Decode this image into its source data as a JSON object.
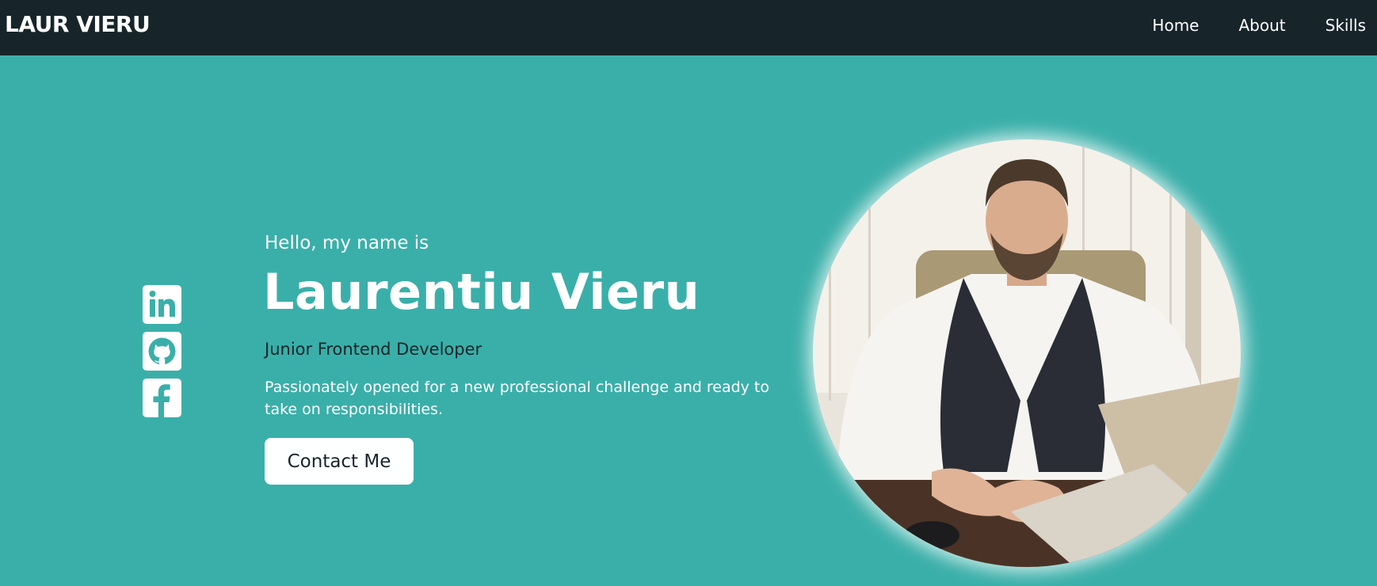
{
  "nav": {
    "brand": "LAUR VIERU",
    "links": [
      {
        "label": "Home"
      },
      {
        "label": "About"
      },
      {
        "label": "Skills"
      }
    ]
  },
  "hero": {
    "greeting": "Hello, my name is",
    "name": "Laurentiu Vieru",
    "role": "Junior Frontend Developer",
    "tagline": "Passionately opened for a new professional challenge and ready to take on responsibilities.",
    "cta_label": "Contact Me"
  },
  "social": [
    {
      "icon": "linkedin-icon"
    },
    {
      "icon": "github-icon"
    },
    {
      "icon": "facebook-icon"
    }
  ],
  "colors": {
    "nav_background": "#17252a",
    "hero_background": "#3aafa9",
    "button_background": "#feffff",
    "dark_text": "#17252a"
  }
}
